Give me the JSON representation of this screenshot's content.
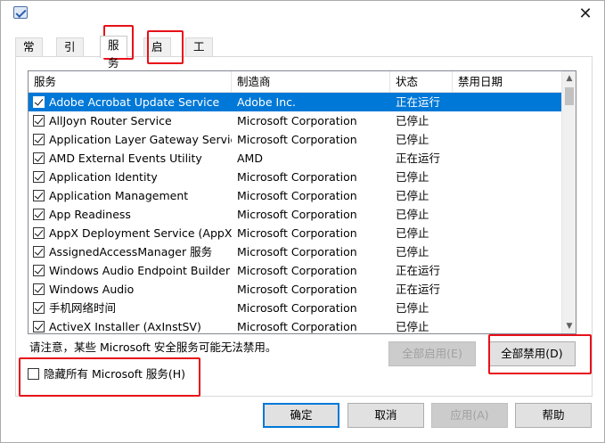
{
  "tabs": [
    {
      "label": "常规"
    },
    {
      "label": "引导"
    },
    {
      "label": "服务"
    },
    {
      "label": "启动"
    },
    {
      "label": "工具"
    }
  ],
  "active_tab": "服务",
  "close_glyph": "✕",
  "columns": {
    "service": "服务",
    "manufacturer": "制造商",
    "status": "状态",
    "disabled_date": "禁用日期"
  },
  "services": [
    {
      "name": "Adobe Acrobat Update Service",
      "manufacturer": "Adobe Inc.",
      "status": "正在运行",
      "date": "",
      "checked": true,
      "selected": true
    },
    {
      "name": "AllJoyn Router Service",
      "manufacturer": "Microsoft Corporation",
      "status": "已停止",
      "date": "",
      "checked": true
    },
    {
      "name": "Application Layer Gateway Service",
      "manufacturer": "Microsoft Corporation",
      "status": "已停止",
      "date": "",
      "checked": true
    },
    {
      "name": "AMD External Events Utility",
      "manufacturer": "AMD",
      "status": "正在运行",
      "date": "",
      "checked": true
    },
    {
      "name": "Application Identity",
      "manufacturer": "Microsoft Corporation",
      "status": "已停止",
      "date": "",
      "checked": true
    },
    {
      "name": "Application Management",
      "manufacturer": "Microsoft Corporation",
      "status": "已停止",
      "date": "",
      "checked": true
    },
    {
      "name": "App Readiness",
      "manufacturer": "Microsoft Corporation",
      "status": "已停止",
      "date": "",
      "checked": true
    },
    {
      "name": "AppX Deployment Service (AppX...",
      "manufacturer": "Microsoft Corporation",
      "status": "已停止",
      "date": "",
      "checked": true
    },
    {
      "name": "AssignedAccessManager 服务",
      "manufacturer": "Microsoft Corporation",
      "status": "已停止",
      "date": "",
      "checked": true
    },
    {
      "name": "Windows Audio Endpoint Builder",
      "manufacturer": "Microsoft Corporation",
      "status": "正在运行",
      "date": "",
      "checked": true
    },
    {
      "name": "Windows Audio",
      "manufacturer": "Microsoft Corporation",
      "status": "正在运行",
      "date": "",
      "checked": true
    },
    {
      "name": "手机网络时间",
      "manufacturer": "Microsoft Corporation",
      "status": "已停止",
      "date": "",
      "checked": true
    },
    {
      "name": "ActiveX Installer (AxInstSV)",
      "manufacturer": "Microsoft Corporation",
      "status": "已停止",
      "date": "",
      "checked": true
    }
  ],
  "note": "请注意，某些 Microsoft 安全服务可能无法禁用。",
  "enable_all": "全部启用(E)",
  "disable_all": "全部禁用(D)",
  "hide_ms": "隐藏所有 Microsoft 服务(H)",
  "buttons": {
    "ok": "确定",
    "cancel": "取消",
    "apply": "应用(A)",
    "help": "帮助"
  },
  "colors": {
    "selection": "#0078d7",
    "highlight": "#e8101a"
  }
}
